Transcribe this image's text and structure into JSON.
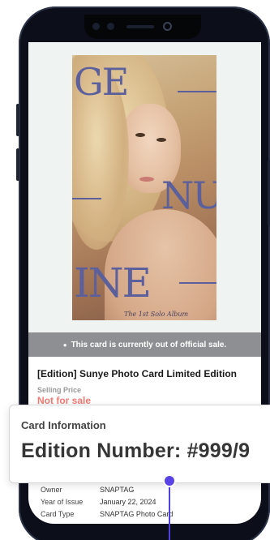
{
  "banner": {
    "icon": "dot-icon",
    "icon_glyph": "●",
    "text": "This card is currently out of official sale."
  },
  "card": {
    "artwork_text": [
      "GE",
      "NU",
      "INE"
    ],
    "album_caption": "The 1st Solo Album",
    "title": "[Edition] Sunye Photo Card Limited Edition",
    "price_label": "Selling Price",
    "price_value": "Not for sale"
  },
  "popup": {
    "label": "Card Information",
    "value": "Edition Number:  #999/9"
  },
  "details": [
    {
      "key": "Owner",
      "value": "SNAPTAG"
    },
    {
      "key": "Year of Issue",
      "value": "January 22, 2024"
    },
    {
      "key": "Card Type",
      "value": "SNAPTAG Photo Card"
    }
  ],
  "colors": {
    "accent_purple": "#5a43e6",
    "price_red": "#f07a73",
    "banner_gray": "#8e8f93",
    "photo_bg": "#eff4f3",
    "artwork_blue": "#5b5f9c"
  }
}
